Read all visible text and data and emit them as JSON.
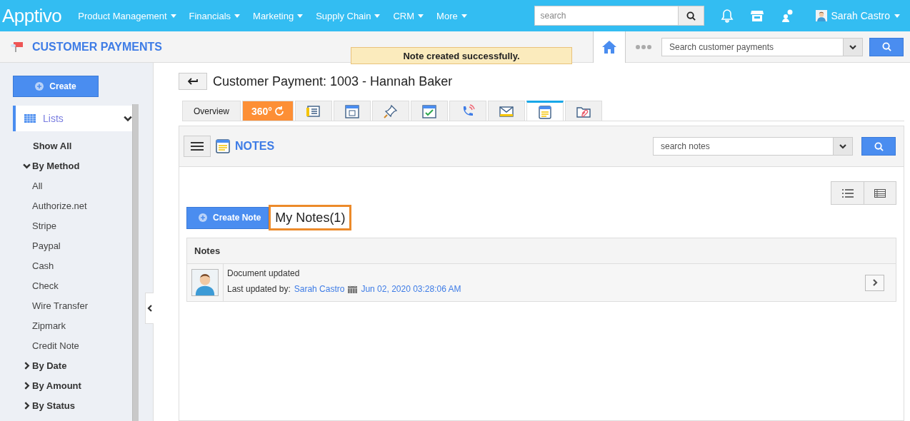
{
  "top_nav": {
    "logo": "Apptivo",
    "menus": [
      {
        "label": "Product Management"
      },
      {
        "label": "Financials"
      },
      {
        "label": "Marketing"
      },
      {
        "label": "Supply Chain"
      },
      {
        "label": "CRM"
      },
      {
        "label": "More"
      }
    ],
    "search": {
      "placeholder": "search"
    },
    "user": "Sarah Castro"
  },
  "app_bar": {
    "title": "CUSTOMER PAYMENTS",
    "toast": "Note created successfully.",
    "search": {
      "placeholder": "Search customer payments"
    }
  },
  "sidebar": {
    "create_button": "Create",
    "lists_label": "Lists",
    "items": [
      {
        "label": "Show All",
        "kind": "link"
      },
      {
        "label": "By Method",
        "kind": "group",
        "expanded": true,
        "children": [
          {
            "label": "All"
          },
          {
            "label": "Authorize.net"
          },
          {
            "label": "Stripe"
          },
          {
            "label": "Paypal"
          },
          {
            "label": "Cash"
          },
          {
            "label": "Check"
          },
          {
            "label": "Wire Transfer"
          },
          {
            "label": "Zipmark"
          },
          {
            "label": "Credit Note"
          }
        ]
      },
      {
        "label": "By Date",
        "kind": "group",
        "expanded": false
      },
      {
        "label": "By Amount",
        "kind": "group",
        "expanded": false
      },
      {
        "label": "By Status",
        "kind": "group",
        "expanded": false
      }
    ]
  },
  "record": {
    "title": "Customer Payment: 1003 - Hannah Baker"
  },
  "tabs": [
    {
      "kind": "text",
      "label": "Overview",
      "selected": false
    },
    {
      "kind": "badge",
      "label": "360°",
      "selected": false
    },
    {
      "kind": "icon",
      "selected": false
    },
    {
      "kind": "icon",
      "selected": false
    },
    {
      "kind": "icon",
      "selected": false
    },
    {
      "kind": "icon",
      "selected": false
    },
    {
      "kind": "icon",
      "selected": false
    },
    {
      "kind": "icon",
      "selected": false
    },
    {
      "kind": "icon",
      "selected": true
    },
    {
      "kind": "icon",
      "selected": false
    }
  ],
  "notes_panel": {
    "title": "NOTES",
    "search": {
      "placeholder": "search notes"
    },
    "create_button": "Create Note",
    "count_label": "My Notes(1)",
    "table_header": "Notes",
    "notes": [
      {
        "text": "Document updated",
        "updated_by_label": "Last updated by:",
        "author": "Sarah Castro",
        "timestamp": "Jun 02, 2020 03:28:06 AM"
      }
    ]
  }
}
